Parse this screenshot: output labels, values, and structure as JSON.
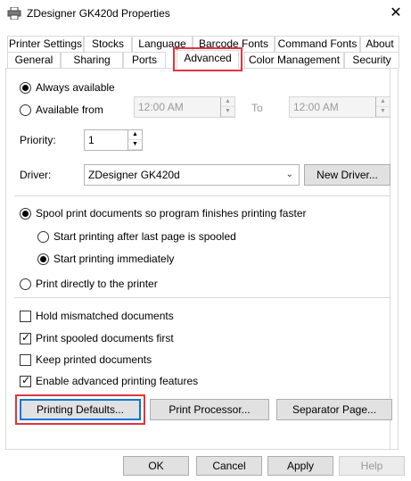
{
  "window": {
    "title": "ZDesigner GK420d Properties",
    "printer_icon": "printer-icon",
    "close_glyph": "✕"
  },
  "tabs": {
    "row1": [
      "Printer Settings",
      "Stocks",
      "Language",
      "Barcode Fonts",
      "Command Fonts",
      "About"
    ],
    "row2": [
      "General",
      "Sharing",
      "Ports",
      "Advanced",
      "Color Management",
      "Security"
    ],
    "active": "Advanced"
  },
  "availability": {
    "always_label": "Always available",
    "from_label": "Available from",
    "from_time": "12:00 AM",
    "to_label": "To",
    "to_time": "12:00 AM",
    "selected": "always"
  },
  "priority": {
    "label": "Priority:",
    "value": "1"
  },
  "driver": {
    "label": "Driver:",
    "value": "ZDesigner GK420d",
    "new_driver_button": "New Driver..."
  },
  "spooling": {
    "spool_label": "Spool print documents so program finishes printing faster",
    "after_last_page_label": "Start printing after last page is spooled",
    "immediately_label": "Start printing immediately",
    "direct_label": "Print directly to the printer",
    "selected": "spool",
    "spool_sub_selected": "immediately"
  },
  "options": {
    "hold_mismatched": {
      "label": "Hold mismatched documents",
      "checked": false
    },
    "print_spooled_first": {
      "label": "Print spooled documents first",
      "checked": true
    },
    "keep_printed": {
      "label": "Keep printed documents",
      "checked": false
    },
    "enable_advanced": {
      "label": "Enable advanced printing features",
      "checked": true
    }
  },
  "buttons": {
    "printing_defaults": "Printing Defaults...",
    "print_processor": "Print Processor...",
    "separator_page": "Separator Page...",
    "ok": "OK",
    "cancel": "Cancel",
    "apply": "Apply",
    "help": "Help"
  },
  "colors": {
    "highlight": "#e0343f",
    "focus": "#0078d7"
  }
}
